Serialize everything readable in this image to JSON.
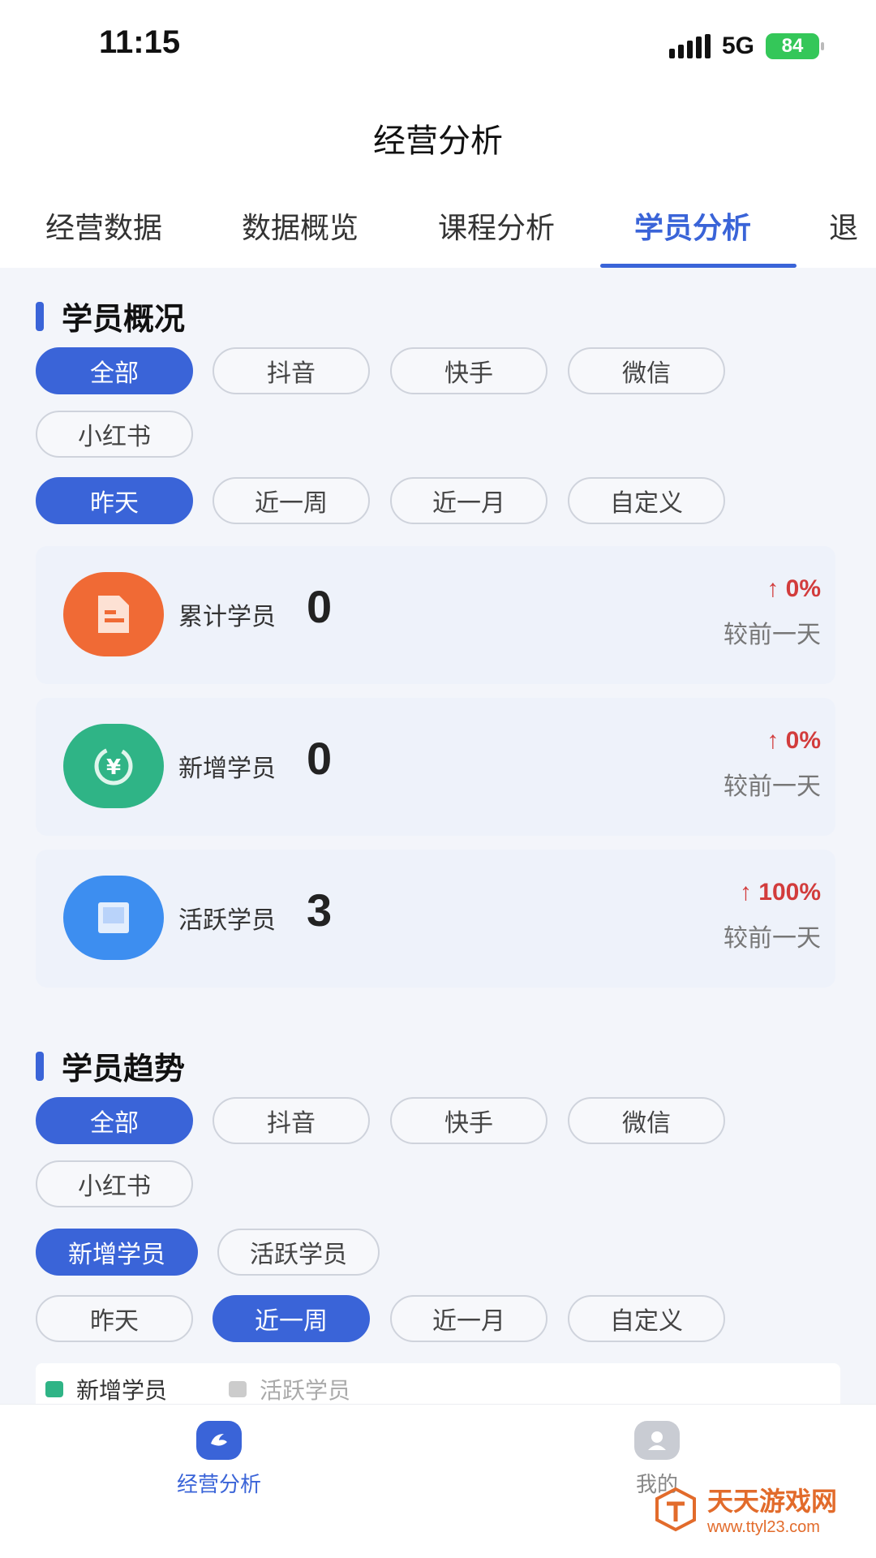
{
  "status_bar": {
    "time": "11:15",
    "network": "5G",
    "battery": "84"
  },
  "header": {
    "title": "经营分析"
  },
  "tabs": [
    {
      "label": "经营数据",
      "active": false
    },
    {
      "label": "数据概览",
      "active": false
    },
    {
      "label": "课程分析",
      "active": false
    },
    {
      "label": "学员分析",
      "active": true
    },
    {
      "label": "退",
      "active": false
    }
  ],
  "overview": {
    "title": "学员概况",
    "platform_filters": [
      "全部",
      "抖音",
      "快手",
      "微信",
      "小红书"
    ],
    "platform_selected": "全部",
    "period_filters": [
      "昨天",
      "近一周",
      "近一月",
      "自定义"
    ],
    "period_selected": "昨天",
    "stats": [
      {
        "label": "累计学员",
        "value": "0",
        "change": "0%",
        "compare": "较前一天",
        "icon": "document-icon",
        "color": "#f06a35"
      },
      {
        "label": "新增学员",
        "value": "0",
        "change": "0%",
        "compare": "较前一天",
        "icon": "yuan-refresh-icon",
        "color": "#2fb486"
      },
      {
        "label": "活跃学员",
        "value": "3",
        "change": "100%",
        "compare": "较前一天",
        "icon": "book-icon",
        "color": "#3d8ef0"
      }
    ]
  },
  "trend": {
    "title": "学员趋势",
    "platform_filters": [
      "全部",
      "抖音",
      "快手",
      "微信",
      "小红书"
    ],
    "platform_selected": "全部",
    "metric_filters": [
      "新增学员",
      "活跃学员"
    ],
    "metric_selected": "新增学员",
    "period_filters": [
      "昨天",
      "近一周",
      "近一月",
      "自定义"
    ],
    "period_selected": "近一周",
    "legend": [
      {
        "label": "新增学员",
        "color": "#2fb486",
        "active": true
      },
      {
        "label": "活跃学员",
        "color": "#cccccc",
        "active": false
      }
    ]
  },
  "bottom_nav": [
    {
      "label": "经营分析",
      "active": true,
      "icon": "analysis-icon"
    },
    {
      "label": "我的",
      "active": false,
      "icon": "profile-icon"
    }
  ],
  "watermark": {
    "name": "天天游戏网",
    "url": "www.ttyl23.com"
  },
  "colors": {
    "accent": "#3a64d8",
    "increase": "#d23c3c"
  }
}
